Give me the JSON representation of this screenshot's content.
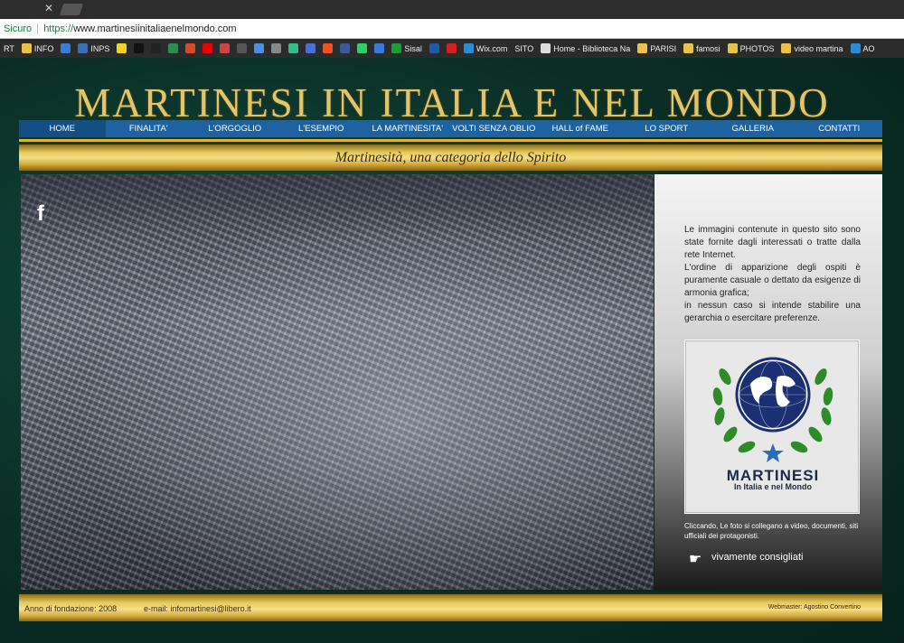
{
  "browser": {
    "secure_label": "Sicuro",
    "url_scheme": "https://",
    "url_rest": "www.martinesiinitaliaenelmondo.com",
    "bookmarks": [
      {
        "label": "RT",
        "icon": "",
        "color": "#2b2b2b"
      },
      {
        "label": "INFO",
        "icon": "folder-icon",
        "color": "#e8c24a"
      },
      {
        "label": "",
        "icon": "arrow-icon",
        "color": "#3a7bd5"
      },
      {
        "label": "INPS",
        "icon": "inps-icon",
        "color": "#3a6fb0"
      },
      {
        "label": "",
        "icon": "pt-icon",
        "color": "#f2d21a"
      },
      {
        "label": "",
        "icon": "x-icon",
        "color": "#111"
      },
      {
        "label": "",
        "icon": "amazon-icon",
        "color": "#222"
      },
      {
        "label": "",
        "icon": "flag-icon",
        "color": "#2e8b57"
      },
      {
        "label": "",
        "icon": "g-icon",
        "color": "#d64a2a"
      },
      {
        "label": "",
        "icon": "youtube-icon",
        "color": "#e00"
      },
      {
        "label": "",
        "icon": "doc-icon",
        "color": "#c44"
      },
      {
        "label": "",
        "icon": "app-icon",
        "color": "#555"
      },
      {
        "label": "",
        "icon": "app-icon",
        "color": "#4a90e2"
      },
      {
        "label": "",
        "icon": "app-icon",
        "color": "#888"
      },
      {
        "label": "",
        "icon": "app-icon",
        "color": "#3b8"
      },
      {
        "label": "",
        "icon": "star-icon",
        "color": "#4a6fd0"
      },
      {
        "label": "",
        "icon": "windows-icon",
        "color": "#f25022"
      },
      {
        "label": "",
        "icon": "facebook-icon",
        "color": "#3b5998"
      },
      {
        "label": "",
        "icon": "whatsapp-icon",
        "color": "#25d366"
      },
      {
        "label": "",
        "icon": "shield-icon",
        "color": "#3a7bd5"
      },
      {
        "label": "Sisal",
        "icon": "sisal-icon",
        "color": "#1a9e3a"
      },
      {
        "label": "",
        "icon": "bar-icon",
        "color": "#1d5aa8"
      },
      {
        "label": "",
        "icon": "b-icon",
        "color": "#c22"
      },
      {
        "label": "Wix.com",
        "icon": "wix-icon",
        "color": "#2a8bd8"
      },
      {
        "label": "SITO",
        "icon": "",
        "color": "#2b2b2b"
      },
      {
        "label": "Home - Biblioteca Na",
        "icon": "page-icon",
        "color": "#ddd"
      },
      {
        "label": "PARISI",
        "icon": "folder-icon",
        "color": "#e8c24a"
      },
      {
        "label": "famosi",
        "icon": "folder-icon",
        "color": "#e8c24a"
      },
      {
        "label": "PHOTOS",
        "icon": "folder-icon",
        "color": "#e8c24a"
      },
      {
        "label": "video martina",
        "icon": "folder-icon",
        "color": "#e8c24a"
      },
      {
        "label": "AO",
        "icon": "wix-icon",
        "color": "#2a8bd8"
      }
    ]
  },
  "site": {
    "title": "MARTINESI IN ITALIA E NEL MONDO",
    "tagline": "Martinesità, una categoria dello Spirito",
    "nav": [
      {
        "label": "HOME",
        "active": true
      },
      {
        "label": "FINALITA'",
        "active": false
      },
      {
        "label": "L'ORGOGLIO",
        "active": false
      },
      {
        "label": "L'ESEMPIO",
        "active": false
      },
      {
        "label": "LA MARTINESITA'",
        "active": false
      },
      {
        "label": "VOLTI SENZA OBLIO",
        "active": false
      },
      {
        "label": "HALL of FAME",
        "active": false
      },
      {
        "label": "LO SPORT",
        "active": false
      },
      {
        "label": "GALLERIA",
        "active": false
      },
      {
        "label": "CONTATTI",
        "active": false
      }
    ],
    "social_icon": "f",
    "disclaimer": [
      "Le immagini contenute in questo sito sono state fornite dagli interessati o tratte dalla rete Internet.",
      "L'ordine di apparizione degli ospiti è puramente casuale o dettato da esigenze di armonia grafica;",
      "in nessun caso si intende stabilire una gerarchia o esercitare preferenze."
    ],
    "logo": {
      "name": "MARTINESI",
      "subtitle": "In Italia e nel Mondo"
    },
    "click_note": "Cliccando, Le foto si collegano a video, documenti, siti ufficiali dei protagonisti.",
    "recommend": "vivamente consigliati",
    "footer": {
      "founded": "Anno di fondazione:  2008",
      "email": "e-mail:  infomartinesi@libero.it",
      "webmaster": "Webmaster: Agostino Convertino"
    }
  },
  "colors": {
    "gold": "#e2c46a",
    "nav_blue": "#1d63a2",
    "bg_green": "#0a2e26"
  }
}
